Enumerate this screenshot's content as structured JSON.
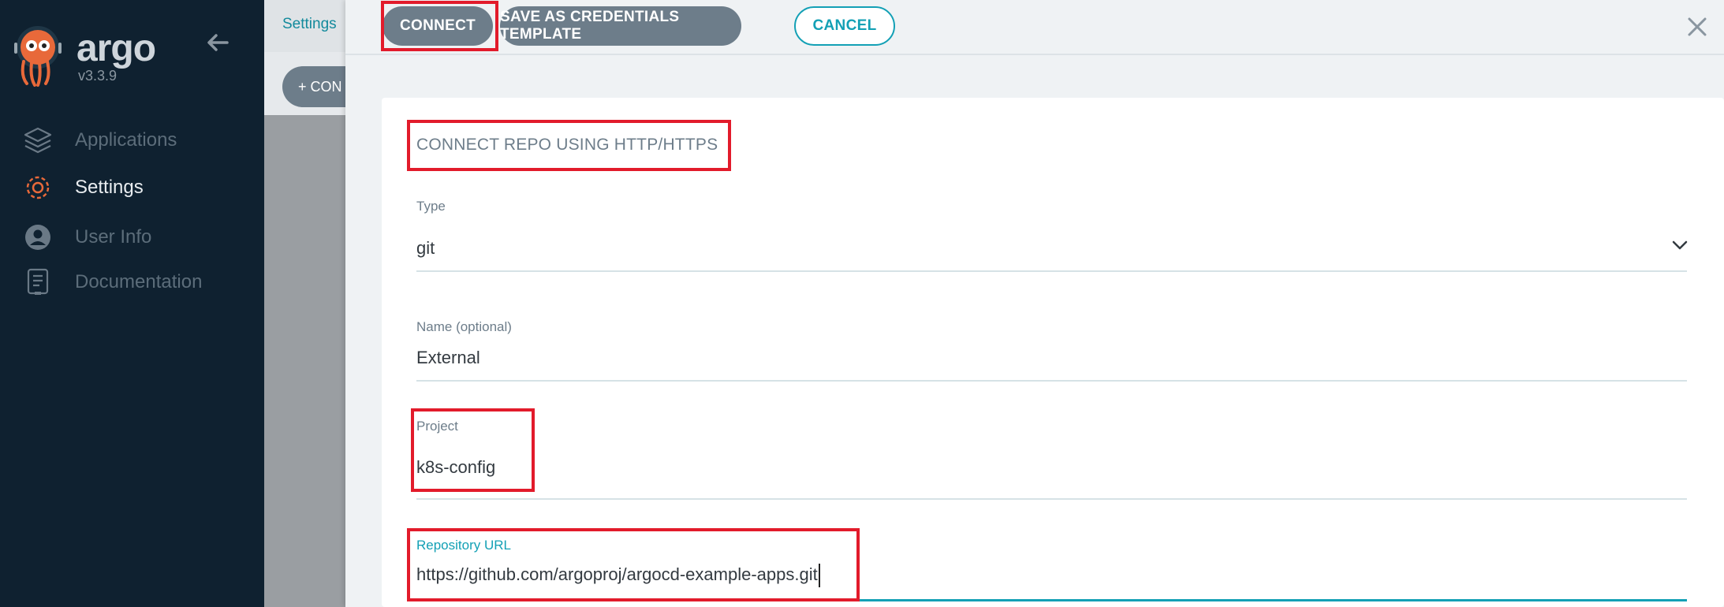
{
  "sidebar": {
    "brand": "argo",
    "version": "v3.3.9",
    "items": [
      {
        "label": "Applications",
        "icon": "layers-icon",
        "active": false
      },
      {
        "label": "Settings",
        "icon": "gear-icon",
        "active": true
      },
      {
        "label": "User Info",
        "icon": "user-icon",
        "active": false
      },
      {
        "label": "Documentation",
        "icon": "documentation-icon",
        "active": false
      }
    ]
  },
  "background": {
    "breadcrumb": "Settings",
    "connect_button": "+ CON"
  },
  "panel": {
    "buttons": {
      "connect": "CONNECT",
      "save_template": "SAVE AS CREDENTIALS TEMPLATE",
      "cancel": "CANCEL"
    },
    "title": "CONNECT REPO USING HTTP/HTTPS",
    "fields": {
      "type": {
        "label": "Type",
        "value": "git"
      },
      "name": {
        "label": "Name (optional)",
        "value": "External"
      },
      "project": {
        "label": "Project",
        "value": "k8s-config"
      },
      "repo_url": {
        "label": "Repository URL",
        "value": "https://github.com/argoproj/argocd-example-apps.git"
      }
    }
  },
  "colors": {
    "sidebar_bg": "#0f2130",
    "accent": "#13a0b5",
    "primary_button": "#6d7d8a",
    "highlight": "#e21b2b"
  }
}
